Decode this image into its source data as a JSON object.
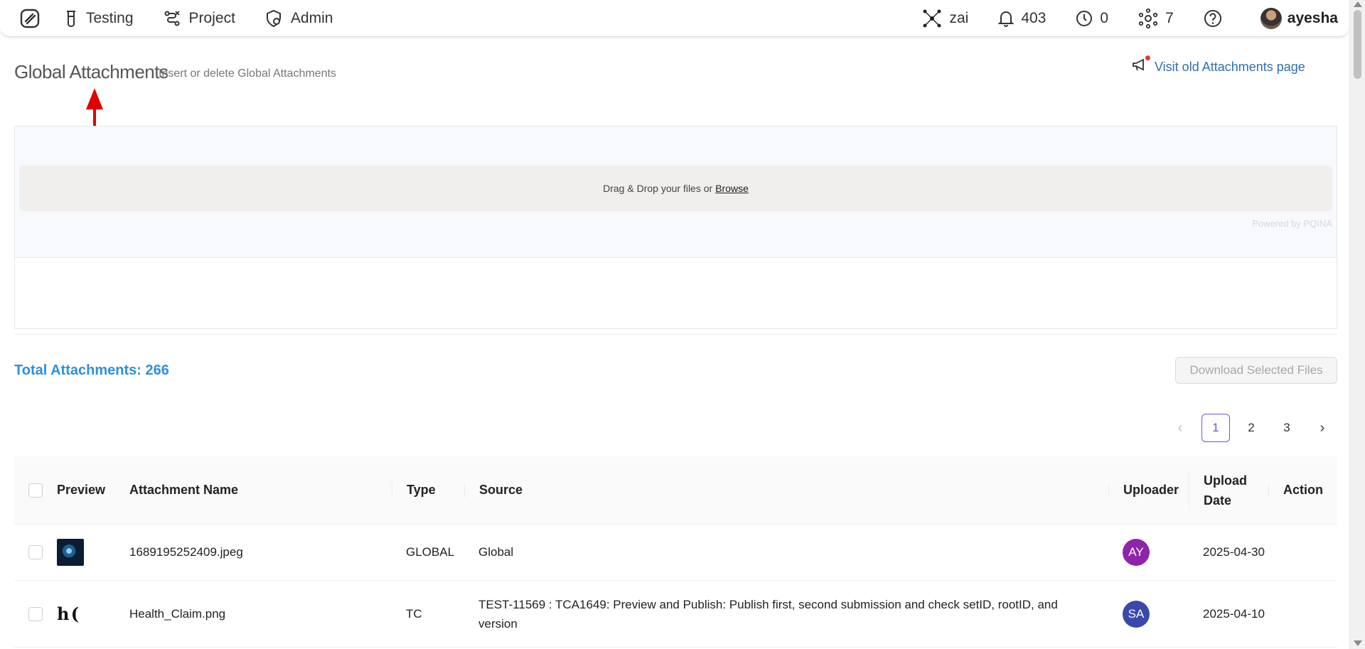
{
  "nav": {
    "items": [
      {
        "label": "Testing",
        "icon": "flask-icon"
      },
      {
        "label": "Project",
        "icon": "route-icon"
      },
      {
        "label": "Admin",
        "icon": "shield-gear-icon"
      }
    ],
    "ai_label": "zai",
    "notifications": "403",
    "pending": "0",
    "integrations": "7",
    "help_icon": "question-circle-icon",
    "username": "ayesha"
  },
  "header": {
    "title": "Global Attachments",
    "subtitle": "Insert or delete Global Attachments",
    "old_link": "Visit old Attachments page"
  },
  "upload": {
    "prompt": "Drag & Drop your files or",
    "browse": "Browse",
    "powered": "Powered by PQINA"
  },
  "summary": {
    "total": "Total Attachments: 266",
    "download_button": "Download Selected Files"
  },
  "pagination": {
    "pages": [
      "1",
      "2",
      "3"
    ],
    "active": "1"
  },
  "table": {
    "columns": {
      "preview": "Preview",
      "name": "Attachment Name",
      "type": "Type",
      "source": "Source",
      "uploader": "Uploader",
      "date": "Upload Date",
      "action": "Action"
    },
    "rows": [
      {
        "name": "1689195252409.jpeg",
        "type": "GLOBAL",
        "source": "Global",
        "uploader": "AY",
        "uploader_color": "#8e24aa",
        "date": "2025-04-30"
      },
      {
        "name": "Health_Claim.png",
        "type": "TC",
        "source": "TEST-11569 : TCA1649: Preview and Publish: Publish first, second submission and check setID, rootID, and version",
        "uploader": "SA",
        "uploader_color": "#3949ab",
        "date": "2025-04-10",
        "thumb_text": "h ("
      }
    ]
  },
  "colors": {
    "accent_link": "#2e6fb5",
    "total_blue": "#2d8fe0",
    "active_page": "#7b4fd6",
    "arrow": "#e00000"
  }
}
